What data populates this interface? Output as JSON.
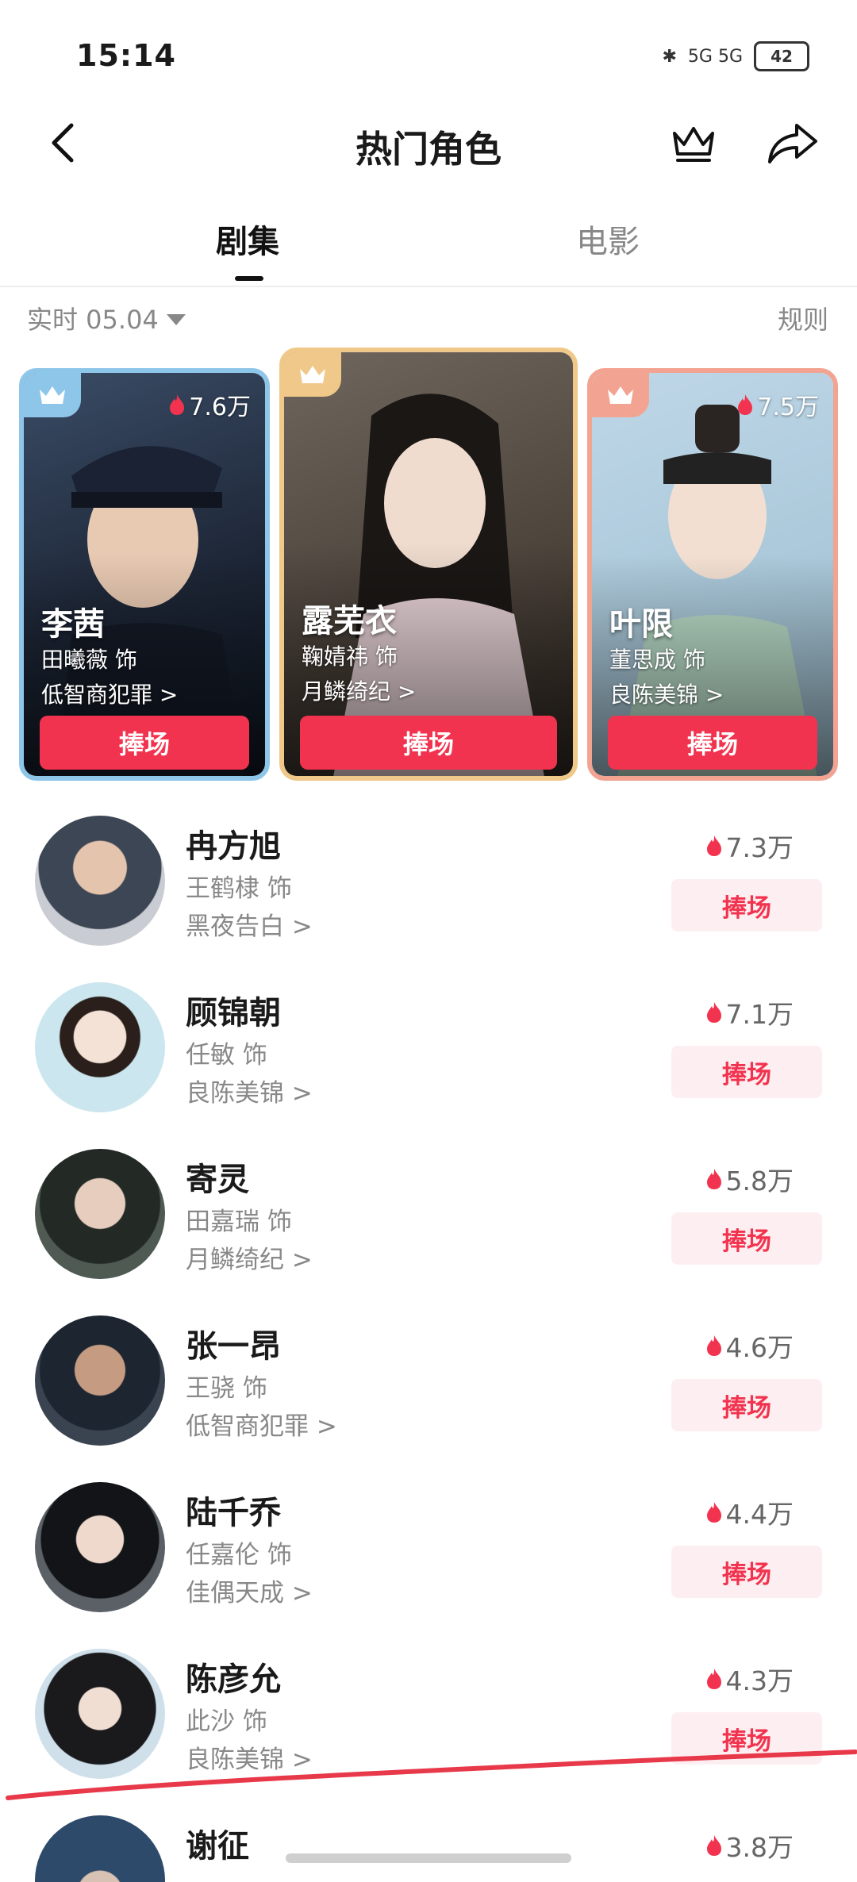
{
  "status": {
    "time": "15:14",
    "signal_text": "5G  5G",
    "battery": "42"
  },
  "nav": {
    "title": "热门角色"
  },
  "tabs": [
    {
      "label": "剧集"
    },
    {
      "label": "电影"
    }
  ],
  "filter": {
    "label": "实时 05.04",
    "rules": "规则"
  },
  "colors": {
    "accent": "#f2334f",
    "accent_light": "#fdeff1",
    "gold": "#f0c98a",
    "blue_frame": "#8ec6ea",
    "salmon_frame": "#f2a391"
  },
  "top_cards": [
    {
      "name": "李茜",
      "actor": "田曦薇 饰",
      "drama": "低智商犯罪 >",
      "heat": "7.6万",
      "button": "捧场"
    },
    {
      "name": "露芜衣",
      "actor": "鞠婧祎 饰",
      "drama": "月鳞绮纪 >",
      "heat": "",
      "button": "捧场"
    },
    {
      "name": "叶限",
      "actor": "董思成 饰",
      "drama": "良陈美锦 >",
      "heat": "7.5万",
      "button": "捧场"
    }
  ],
  "list": [
    {
      "name": "冉方旭",
      "actor": "王鹤棣 饰",
      "drama": "黑夜告白 >",
      "heat": "7.3万",
      "button": "捧场"
    },
    {
      "name": "顾锦朝",
      "actor": "任敏 饰",
      "drama": "良陈美锦 >",
      "heat": "7.1万",
      "button": "捧场"
    },
    {
      "name": "寄灵",
      "actor": "田嘉瑞 饰",
      "drama": "月鳞绮纪 >",
      "heat": "5.8万",
      "button": "捧场"
    },
    {
      "name": "张一昂",
      "actor": "王骁 饰",
      "drama": "低智商犯罪 >",
      "heat": "4.6万",
      "button": "捧场"
    },
    {
      "name": "陆千乔",
      "actor": "任嘉伦 饰",
      "drama": "佳偶天成 >",
      "heat": "4.4万",
      "button": "捧场"
    },
    {
      "name": "陈彦允",
      "actor": "此沙 饰",
      "drama": "良陈美锦 >",
      "heat": "4.3万",
      "button": "捧场"
    },
    {
      "name": "谢征",
      "actor": "",
      "drama": "",
      "heat": "3.8万",
      "button": ""
    }
  ]
}
